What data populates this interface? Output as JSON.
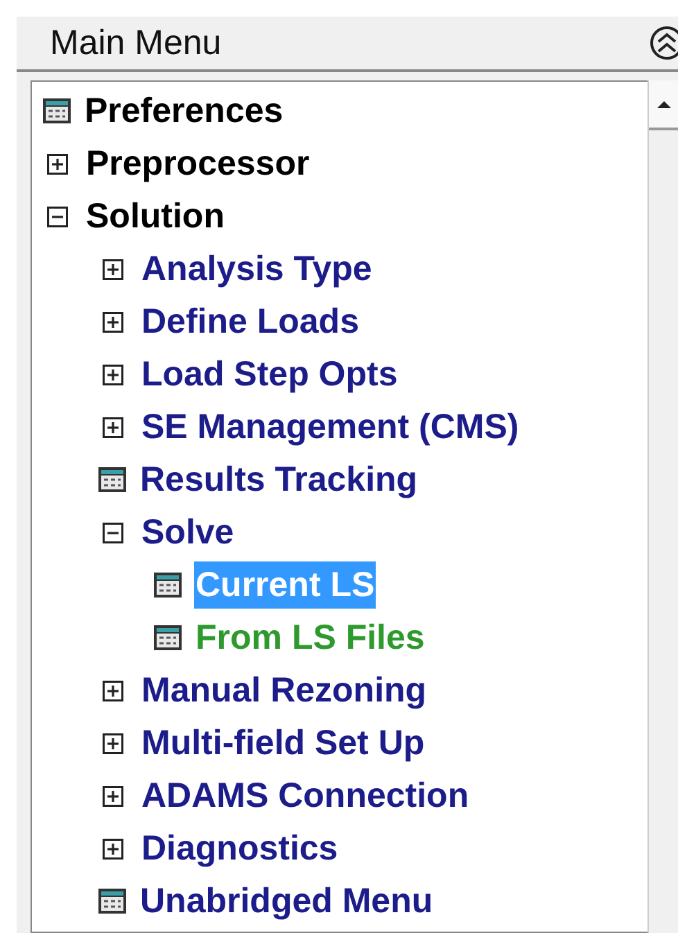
{
  "panel": {
    "title": "Main Menu"
  },
  "tree": [
    {
      "label": "Preferences",
      "kind": "action",
      "selected": false,
      "color": "#000000"
    },
    {
      "label": "Preprocessor",
      "kind": "folder",
      "expanded": false,
      "selected": false,
      "color": "#000000"
    },
    {
      "label": "Solution",
      "kind": "folder",
      "expanded": true,
      "selected": false,
      "color": "#000000",
      "children": [
        {
          "label": "Analysis Type",
          "kind": "folder",
          "expanded": false,
          "selected": false,
          "color": "#1c1c8a"
        },
        {
          "label": "Define Loads",
          "kind": "folder",
          "expanded": false,
          "selected": false,
          "color": "#1c1c8a"
        },
        {
          "label": "Load Step Opts",
          "kind": "folder",
          "expanded": false,
          "selected": false,
          "color": "#1c1c8a"
        },
        {
          "label": "SE Management (CMS)",
          "kind": "folder",
          "expanded": false,
          "selected": false,
          "color": "#1c1c8a"
        },
        {
          "label": "Results Tracking",
          "kind": "action",
          "selected": false,
          "color": "#1c1c8a"
        },
        {
          "label": "Solve",
          "kind": "folder",
          "expanded": true,
          "selected": false,
          "color": "#1c1c8a",
          "children": [
            {
              "label": "Current LS",
              "kind": "action",
              "selected": true
            },
            {
              "label": "From LS Files",
              "kind": "action",
              "selected": false,
              "color": "#2e9a2e"
            }
          ]
        },
        {
          "label": "Manual Rezoning",
          "kind": "folder",
          "expanded": false,
          "selected": false,
          "color": "#1c1c8a"
        },
        {
          "label": "Multi-field Set Up",
          "kind": "folder",
          "expanded": false,
          "selected": false,
          "color": "#1c1c8a"
        },
        {
          "label": "ADAMS Connection",
          "kind": "folder",
          "expanded": false,
          "selected": false,
          "color": "#1c1c8a"
        },
        {
          "label": "Diagnostics",
          "kind": "folder",
          "expanded": false,
          "selected": false,
          "color": "#1c1c8a"
        },
        {
          "label": "Unabridged Menu",
          "kind": "action",
          "selected": false,
          "color": "#1c1c8a"
        }
      ]
    }
  ]
}
